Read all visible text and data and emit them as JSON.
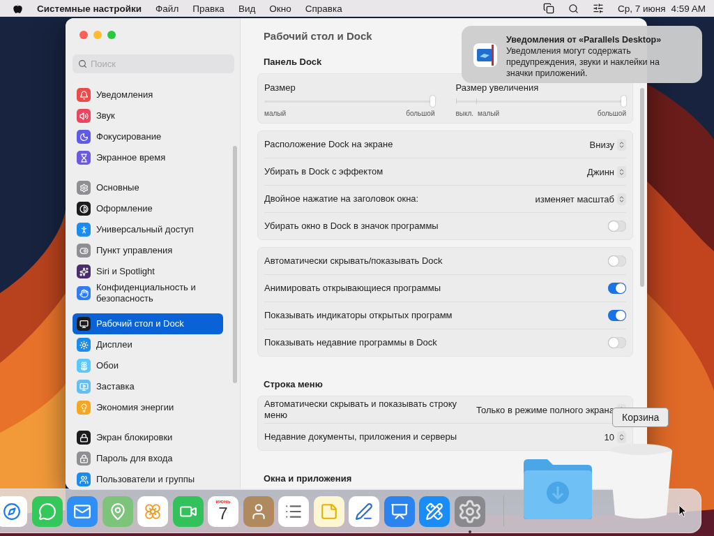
{
  "menubar": {
    "app": "Системные настройки",
    "menus": [
      "Файл",
      "Правка",
      "Вид",
      "Окно",
      "Справка"
    ],
    "date": "Ср, 7 июня",
    "time": "4:59 AM"
  },
  "window": {
    "title": "Рабочий стол и Dock"
  },
  "sidebar": {
    "search": {
      "placeholder": "Поиск"
    },
    "groups": [
      [
        {
          "label": "Уведомления",
          "kind": "bell",
          "color": "#eb4b4b",
          "selected": false
        },
        {
          "label": "Звук",
          "kind": "speaker",
          "color": "#ec4561",
          "selected": false
        },
        {
          "label": "Фокусирование",
          "kind": "moon",
          "color": "#5e5ce6",
          "selected": false
        },
        {
          "label": "Экранное время",
          "kind": "hourglass",
          "color": "#6a5ae0",
          "selected": false
        }
      ],
      [
        {
          "label": "Основные",
          "kind": "gear",
          "color": "#8e8e93",
          "selected": false
        },
        {
          "label": "Оформление",
          "kind": "contrast",
          "color": "#1c1c1e",
          "selected": false
        },
        {
          "label": "Универсальный доступ",
          "kind": "person",
          "color": "#1a8cf0",
          "selected": false
        },
        {
          "label": "Пункт управления",
          "kind": "toggles",
          "color": "#8e8e93",
          "selected": false
        },
        {
          "label": "Siri и Spotlight",
          "kind": "orb",
          "color": "#4a2d6c",
          "selected": false
        },
        {
          "label": "Конфиденциальность и безопасность",
          "kind": "hand",
          "color": "#2f7cf6",
          "selected": false
        }
      ],
      [
        {
          "label": "Рабочий стол и Dock",
          "kind": "dock",
          "color": "#1c1c1e",
          "selected": true
        },
        {
          "label": "Дисплеи",
          "kind": "sun",
          "color": "#1a8cf0",
          "selected": false
        },
        {
          "label": "Обои",
          "kind": "flower",
          "color": "#5ac8fa",
          "selected": false
        },
        {
          "label": "Заставка",
          "kind": "screen",
          "color": "#64bff0",
          "selected": false
        },
        {
          "label": "Экономия энергии",
          "kind": "bulb",
          "color": "#f5a623",
          "selected": false
        }
      ],
      [
        {
          "label": "Экран блокировки",
          "kind": "lock",
          "color": "#1c1c1e",
          "selected": false
        },
        {
          "label": "Пароль для входа",
          "kind": "padlock",
          "color": "#8e8e93",
          "selected": false
        },
        {
          "label": "Пользователи и группы",
          "kind": "users",
          "color": "#1a8cf0",
          "selected": false
        }
      ]
    ]
  },
  "content": {
    "sections": [
      {
        "heading": "Панель Dock",
        "cards": [
          {
            "kind": "sliders",
            "sliders": [
              {
                "label": "Размер",
                "level": 1,
                "marks": [
                  "малый",
                  "большой"
                ]
              },
              {
                "label": "Размер увеличения",
                "level": 1,
                "marks": [
                  "выкл.",
                  "малый",
                  "большой"
                ]
              }
            ]
          },
          {
            "kind": "rows",
            "rows": [
              {
                "kind": "select",
                "label": "Расположение Dock на экране",
                "value": "Внизу"
              },
              {
                "kind": "select",
                "label": "Убирать в Dock с эффектом",
                "value": "Джинн"
              },
              {
                "kind": "select",
                "label": "Двойное нажатие на заголовок окна:",
                "value": "изменяет масштаб"
              },
              {
                "kind": "toggle",
                "label": "Убирать окно в Dock в значок программы",
                "on": false
              }
            ]
          },
          {
            "kind": "rows",
            "rows": [
              {
                "kind": "toggle",
                "label": "Автоматически скрывать/показывать Dock",
                "on": false
              },
              {
                "kind": "toggle",
                "label": "Анимировать открывающиеся программы",
                "on": true
              },
              {
                "kind": "toggle",
                "label": "Показывать индикаторы открытых программ",
                "on": true
              },
              {
                "kind": "toggle",
                "label": "Показывать недавние программы в Dock",
                "on": false
              }
            ]
          }
        ]
      },
      {
        "heading": "Строка меню",
        "cards": [
          {
            "kind": "rows",
            "rows": [
              {
                "kind": "select",
                "label": "Автоматически скрывать и показывать строку меню",
                "value": "Только в режиме полного экрана"
              },
              {
                "kind": "select",
                "label": "Недавние документы, приложения и серверы",
                "value": "10"
              }
            ]
          }
        ]
      },
      {
        "heading": "Окна и приложения"
      }
    ]
  },
  "notification": {
    "title": "Уведомления от «Parallels Desktop»",
    "body": "Уведомления могут содержать предупреждения, звуки и наклейки на значки приложений."
  },
  "dock": {
    "apps": [
      {
        "kind": "safari",
        "running": false
      },
      {
        "kind": "messages",
        "running": false
      },
      {
        "kind": "mail",
        "running": false
      },
      {
        "kind": "maps",
        "running": false
      },
      {
        "kind": "photos",
        "running": false
      },
      {
        "kind": "facetime",
        "running": false
      },
      {
        "kind": "calendar",
        "month": "июнь",
        "day": "7",
        "running": false
      },
      {
        "kind": "contacts",
        "running": false
      },
      {
        "kind": "reminders",
        "running": false
      },
      {
        "kind": "notes",
        "running": false
      },
      {
        "kind": "freeform",
        "running": false
      },
      {
        "kind": "keynote",
        "running": false
      },
      {
        "kind": "appstore",
        "running": false
      },
      {
        "kind": "settings",
        "running": true
      }
    ],
    "tooltip": "Корзина"
  }
}
